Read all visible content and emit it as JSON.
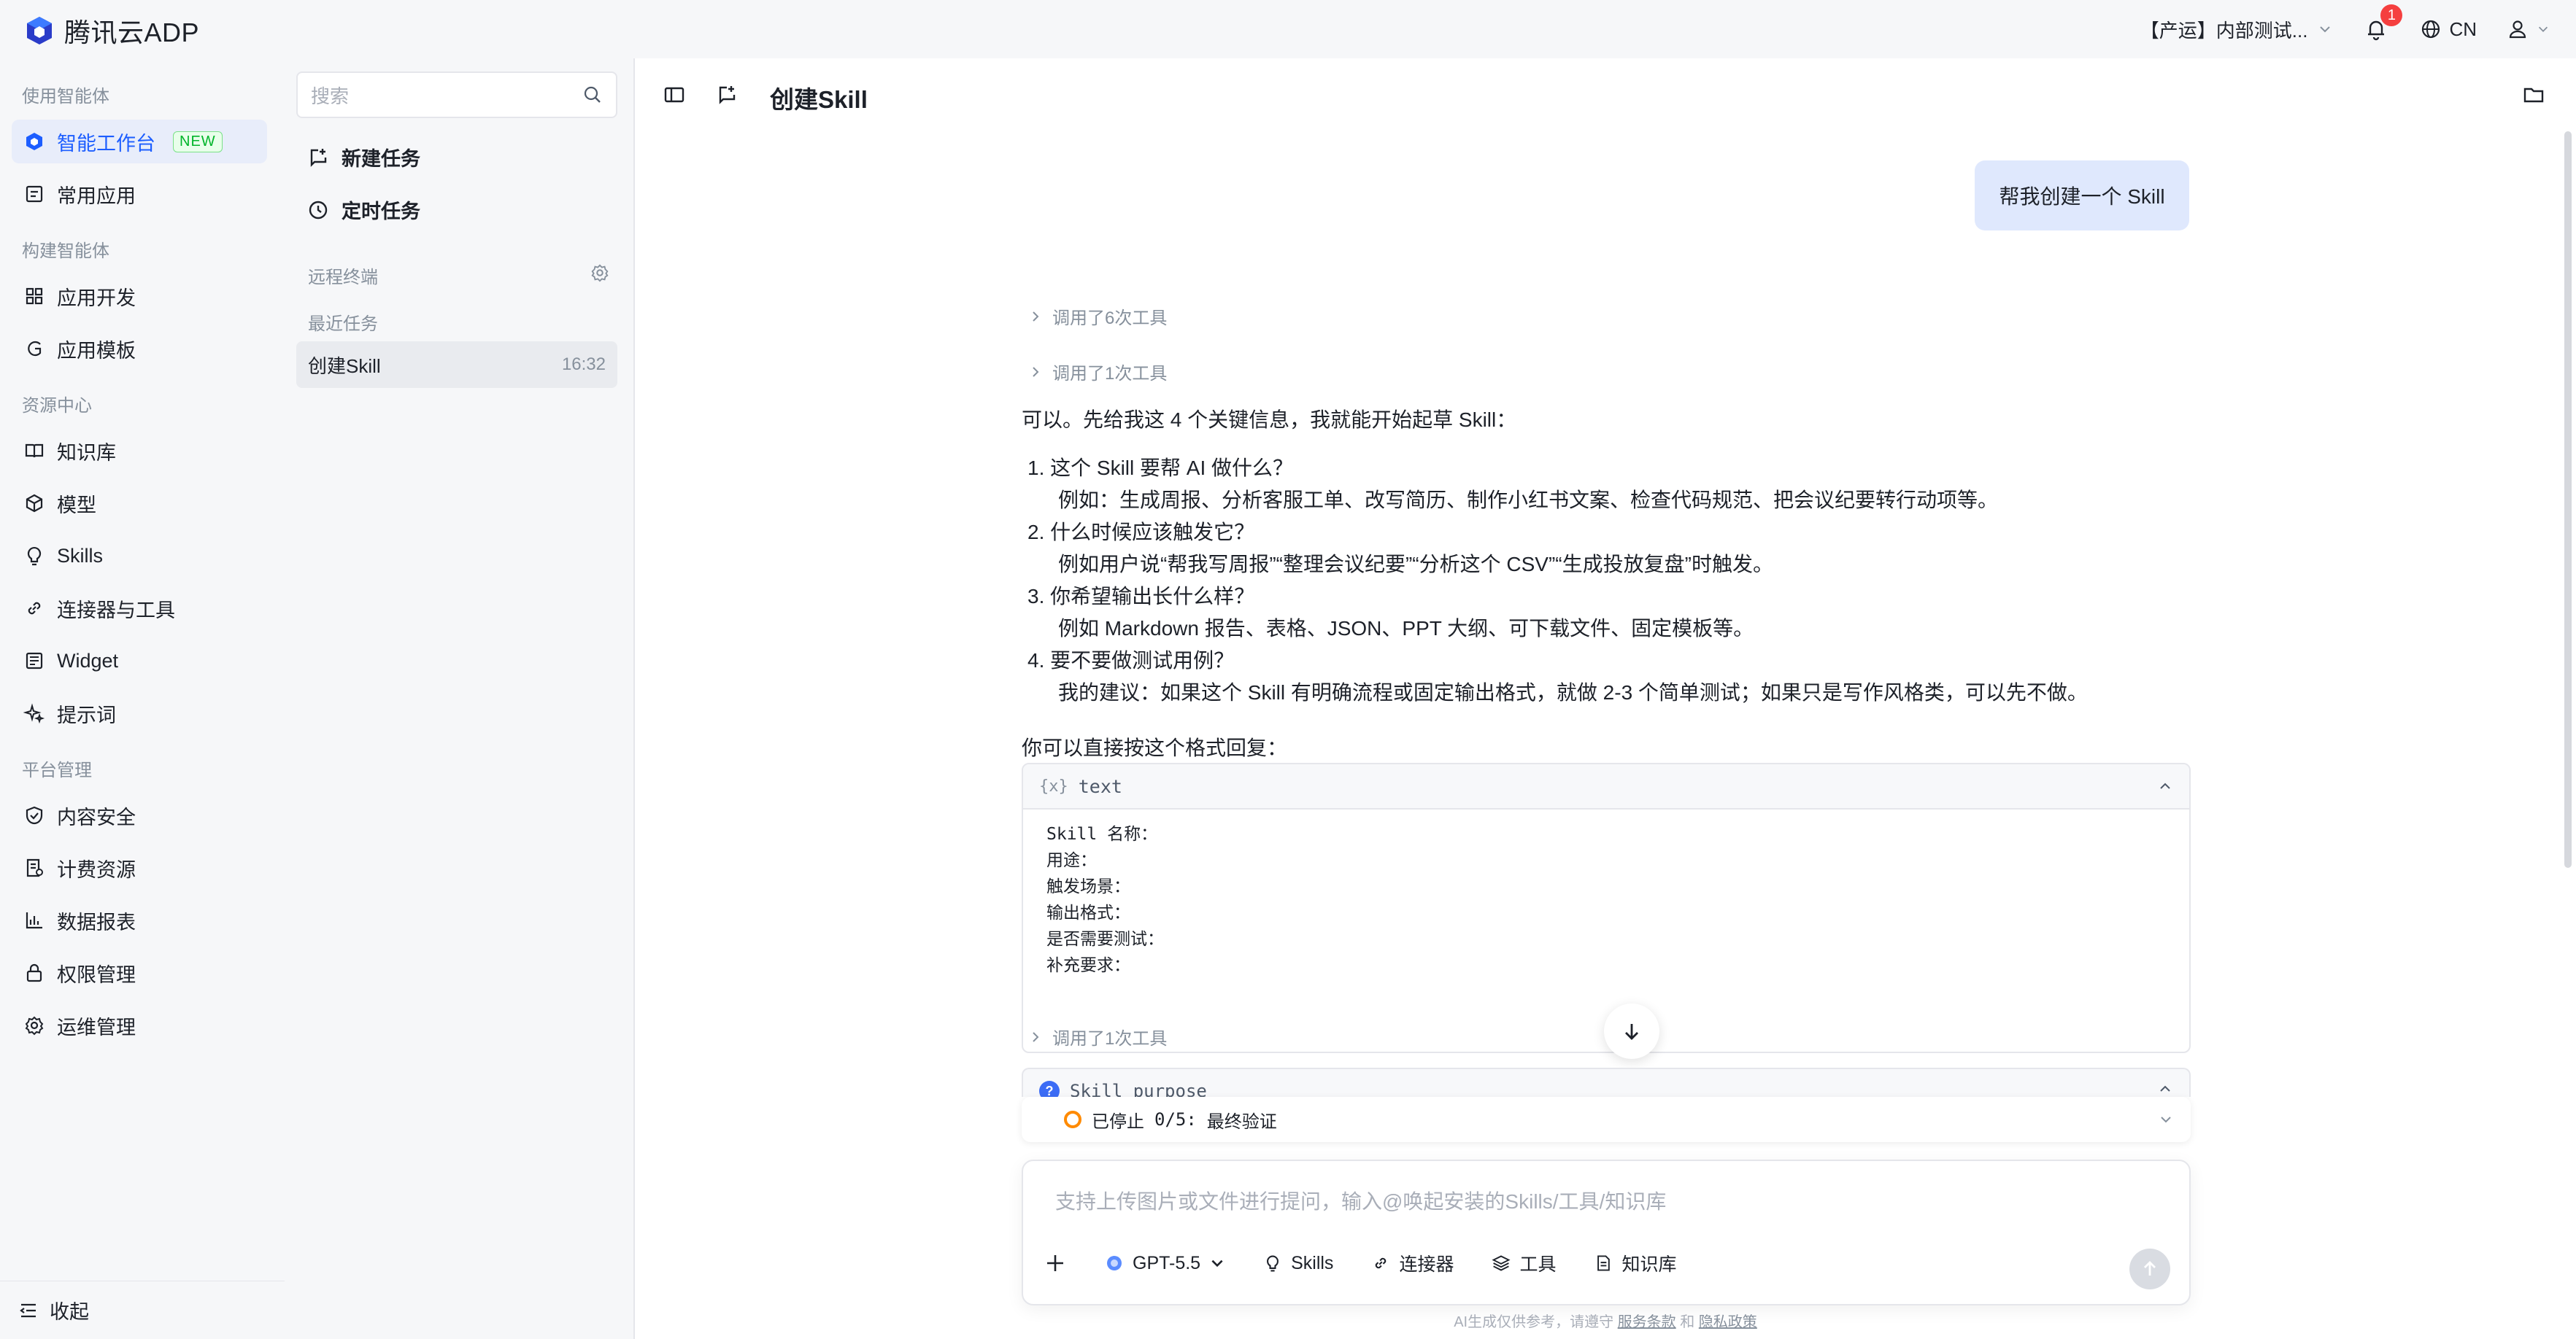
{
  "header": {
    "logo_text": "腾讯云ADP",
    "project": "【产运】内部测试...",
    "notification_count": "1",
    "language": "CN"
  },
  "sidebar": {
    "groups": [
      {
        "label": "使用智能体"
      },
      {
        "label": "构建智能体"
      },
      {
        "label": "资源中心"
      },
      {
        "label": "平台管理"
      }
    ],
    "items": [
      {
        "label": "智能工作台",
        "badge": "NEW",
        "icon": "workbench-icon"
      },
      {
        "label": "常用应用",
        "icon": "app-list-icon"
      },
      {
        "label": "应用开发",
        "icon": "grid-icon"
      },
      {
        "label": "应用模板",
        "icon": "template-icon"
      },
      {
        "label": "知识库",
        "icon": "book-icon"
      },
      {
        "label": "模型",
        "icon": "cube-icon"
      },
      {
        "label": "Skills",
        "icon": "bulb-icon"
      },
      {
        "label": "连接器与工具",
        "icon": "link-icon"
      },
      {
        "label": "Widget",
        "icon": "widget-icon"
      },
      {
        "label": "提示词",
        "icon": "sparkle-icon"
      },
      {
        "label": "内容安全",
        "icon": "shield-icon"
      },
      {
        "label": "计费资源",
        "icon": "billing-icon"
      },
      {
        "label": "数据报表",
        "icon": "bar-chart-icon"
      },
      {
        "label": "权限管理",
        "icon": "lock-icon"
      },
      {
        "label": "运维管理",
        "icon": "gear-icon"
      }
    ],
    "collapse_label": "收起"
  },
  "tasks": {
    "search_placeholder": "搜索",
    "new_task": "新建任务",
    "scheduled_task": "定时任务",
    "remote_terminal": "远程终端",
    "recent_label": "最近任务",
    "recent": [
      {
        "name": "创建Skill",
        "time": "16:32"
      }
    ]
  },
  "main": {
    "title": "创建Skill",
    "user_message": "帮我创建一个 Skill",
    "tool_calls": [
      "调用了6次工具",
      "调用了1次工具",
      "调用了1次工具"
    ],
    "intro": "可以。先给我这 4 个关键信息，我就能开始起草 Skill：",
    "list": [
      {
        "q": "1. 这个 Skill 要帮 AI 做什么？",
        "detail": "例如：生成周报、分析客服工单、改写简历、制作小红书文案、检查代码规范、把会议纪要转行动项等。"
      },
      {
        "q": "2. 什么时候应该触发它？",
        "detail": "例如用户说“帮我写周报”“整理会议纪要”“分析这个 CSV”“生成投放复盘”时触发。"
      },
      {
        "q": "3. 你希望输出长什么样？",
        "detail": "例如 Markdown 报告、表格、JSON、PPT 大纲、可下载文件、固定模板等。"
      },
      {
        "q": "4. 要不要做测试用例？",
        "detail": "我的建议：如果这个 Skill 有明确流程或固定输出格式，就做 2-3 个简单测试；如果只是写作风格类，可以先不做。"
      }
    ],
    "reply_hint": "你可以直接按这个格式回复：",
    "code": {
      "lang": "text",
      "lines": [
        "Skill 名称：",
        "用途：",
        "触发场景：",
        "输出格式：",
        "是否需要测试：",
        "补充要求："
      ]
    },
    "purpose_label": "Skill purpose",
    "status": {
      "text": "已停止",
      "progress": "0/5:",
      "step": "最终验证"
    },
    "composer": {
      "placeholder": "支持上传图片或文件进行提问，输入@唤起安装的Skills/工具/知识库",
      "model": "GPT-5.5",
      "tools": [
        "Skills",
        "连接器",
        "工具",
        "知识库"
      ]
    },
    "footer": {
      "text": "AI生成仅供参考，请遵守",
      "terms": "服务条款",
      "and": "和",
      "privacy": "隐私政策"
    }
  },
  "colors": {
    "accent": "#1d5eff",
    "badge": "#f53f3f",
    "stopped": "#ff8a00",
    "user_bubble": "#dfe8fd"
  }
}
